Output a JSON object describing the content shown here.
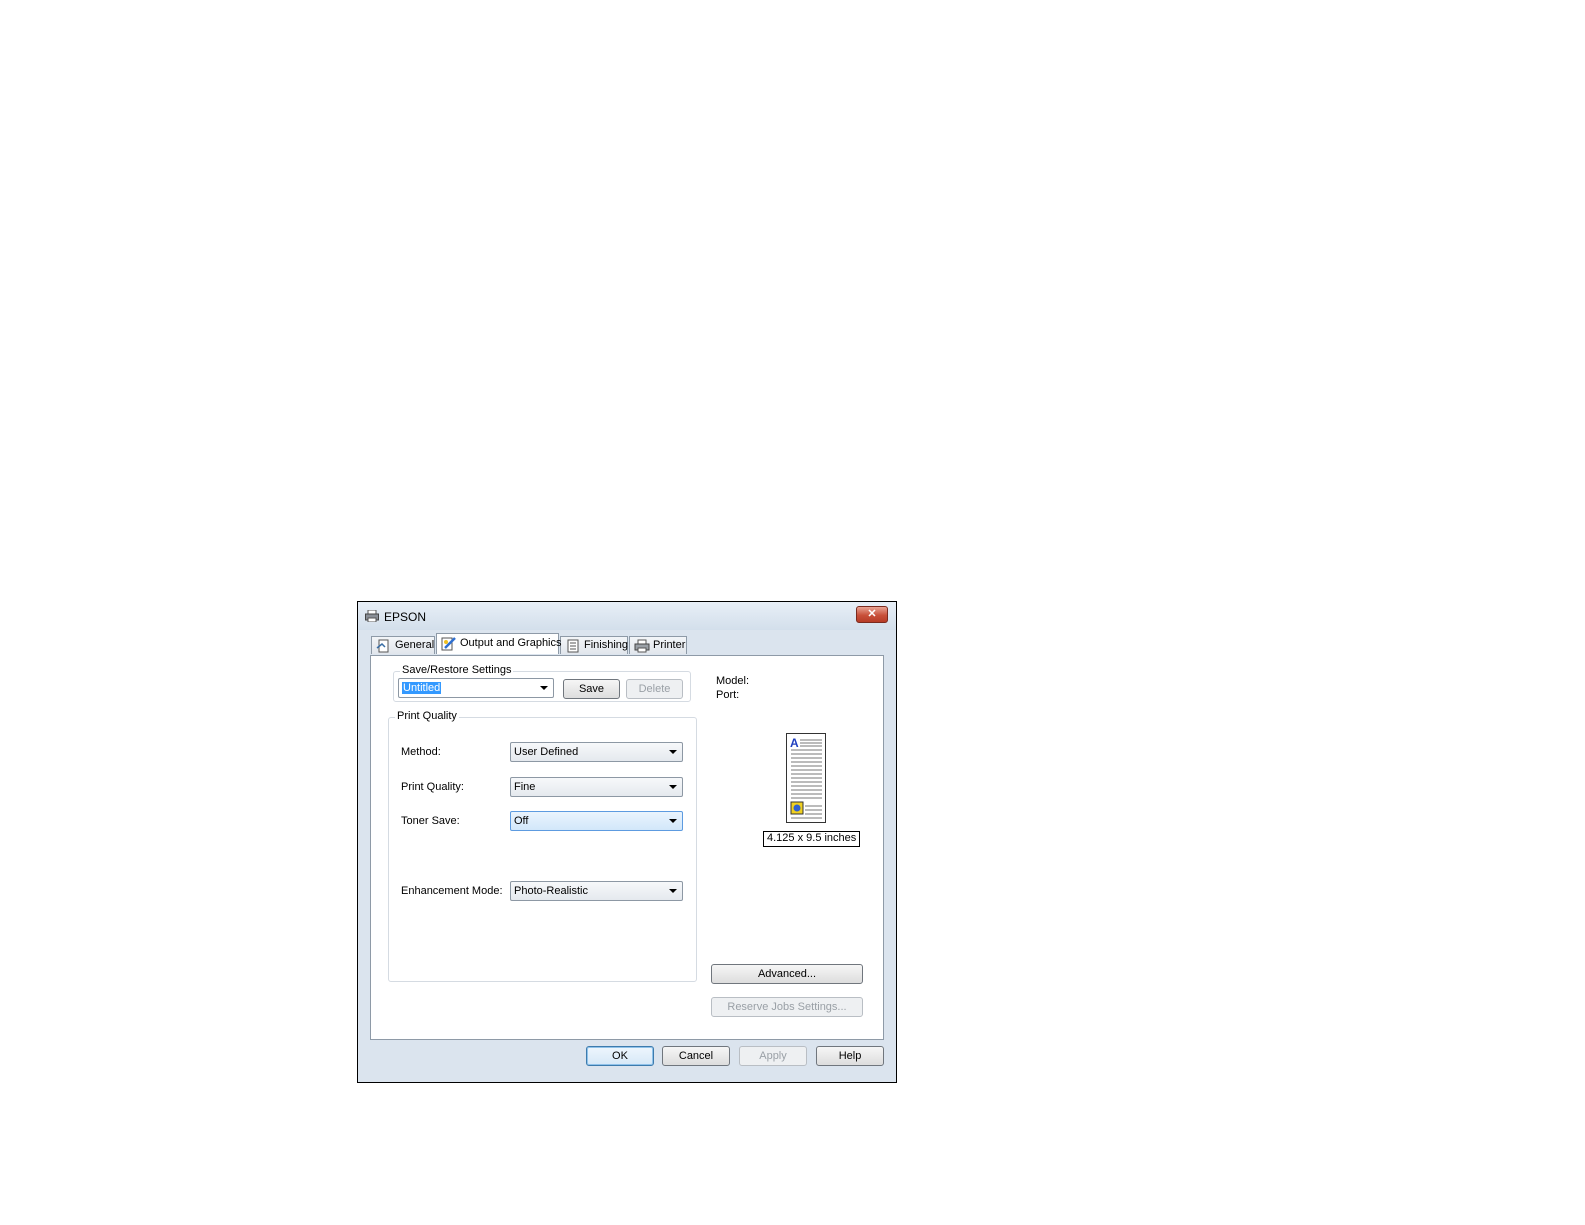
{
  "window": {
    "title": "EPSON",
    "close_icon": "close-icon"
  },
  "tabs": [
    {
      "label": "General",
      "icon": "document-icon",
      "active": false
    },
    {
      "label": "Output and Graphics",
      "icon": "output-graphics-icon",
      "active": true
    },
    {
      "label": "Finishing",
      "icon": "finishing-icon",
      "active": false
    },
    {
      "label": "Printer",
      "icon": "printer-icon",
      "active": false
    }
  ],
  "save_restore": {
    "group_label": "Save/Restore Settings",
    "combo_value": "Untitled",
    "save_label": "Save",
    "delete_label": "Delete"
  },
  "print_quality": {
    "group_label": "Print Quality",
    "method_label": "Method:",
    "method_value": "User Defined",
    "quality_label": "Print Quality:",
    "quality_value": "Fine",
    "toner_label": "Toner Save:",
    "toner_value": "Off",
    "enhancement_label": "Enhancement Mode:",
    "enhancement_value": "Photo-Realistic"
  },
  "info": {
    "model_label": "Model:",
    "port_label": "Port:",
    "paper_size": "4.125 x 9.5 inches"
  },
  "side_buttons": {
    "advanced": "Advanced...",
    "reserve_jobs": "Reserve Jobs Settings..."
  },
  "footer": {
    "ok": "OK",
    "cancel": "Cancel",
    "apply": "Apply",
    "help": "Help"
  }
}
